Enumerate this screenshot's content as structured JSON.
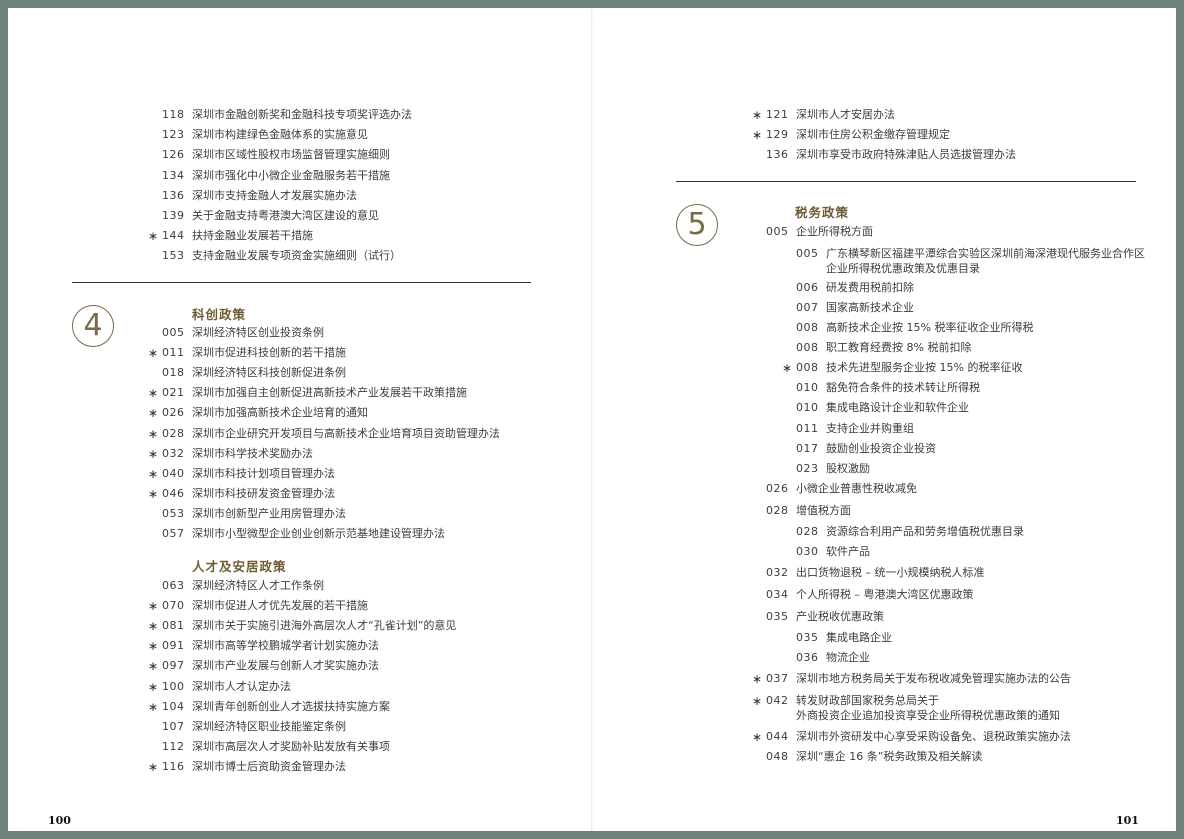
{
  "left": {
    "top_items": [
      {
        "num": "118",
        "title": "深圳市金融创新奖和金融科技专项奖评选办法",
        "star": false
      },
      {
        "num": "123",
        "title": "深圳市构建绿色金融体系的实施意见",
        "star": false
      },
      {
        "num": "126",
        "title": "深圳市区域性股权市场监督管理实施细则",
        "star": false
      },
      {
        "num": "134",
        "title": "深圳市强化中小微企业金融服务若干措施",
        "star": false
      },
      {
        "num": "136",
        "title": "深圳市支持金融人才发展实施办法",
        "star": false
      },
      {
        "num": "139",
        "title": "关于金融支持粤港澳大湾区建设的意见",
        "star": false
      },
      {
        "num": "144",
        "title": "扶持金融业发展若干措施",
        "star": true
      },
      {
        "num": "153",
        "title": "支持金融业发展专项资金实施细则（试行）",
        "star": false
      }
    ],
    "section_number": "4",
    "heading_kechuang": "科创政策",
    "kechuang_items": [
      {
        "num": "005",
        "title": "深圳经济特区创业投资条例",
        "star": false
      },
      {
        "num": "011",
        "title": "深圳市促进科技创新的若干措施",
        "star": true
      },
      {
        "num": "018",
        "title": "深圳经济特区科技创新促进条例",
        "star": false
      },
      {
        "num": "021",
        "title": "深圳市加强自主创新促进高新技术产业发展若干政策措施",
        "star": true
      },
      {
        "num": "026",
        "title": "深圳市加强高新技术企业培育的通知",
        "star": true
      },
      {
        "num": "028",
        "title": "深圳市企业研究开发项目与高新技术企业培育项目资助管理办法",
        "star": true
      },
      {
        "num": "032",
        "title": "深圳市科学技术奖励办法",
        "star": true
      },
      {
        "num": "040",
        "title": "深圳市科技计划项目管理办法",
        "star": true
      },
      {
        "num": "046",
        "title": "深圳市科技研发资金管理办法",
        "star": true
      },
      {
        "num": "053",
        "title": "深圳市创新型产业用房管理办法",
        "star": false
      },
      {
        "num": "057",
        "title": "深圳市小型微型企业创业创新示范基地建设管理办法",
        "star": false
      }
    ],
    "heading_rencai": "人才及安居政策",
    "rencai_items": [
      {
        "num": "063",
        "title": "深圳经济特区人才工作条例",
        "star": false
      },
      {
        "num": "070",
        "title": "深圳市促进人才优先发展的若干措施",
        "star": true
      },
      {
        "num": "081",
        "title": "深圳市关于实施引进海外高层次人才“孔雀计划”的意见",
        "star": true
      },
      {
        "num": "091",
        "title": "深圳市高等学校鹏城学者计划实施办法",
        "star": true
      },
      {
        "num": "097",
        "title": "深圳市产业发展与创新人才奖实施办法",
        "star": true
      },
      {
        "num": "100",
        "title": "深圳市人才认定办法",
        "star": true
      },
      {
        "num": "104",
        "title": "深圳青年创新创业人才选拔扶持实施方案",
        "star": true
      },
      {
        "num": "107",
        "title": "深圳经济特区职业技能鉴定条例",
        "star": false
      },
      {
        "num": "112",
        "title": "深圳市高层次人才奖励补贴发放有关事项",
        "star": false
      },
      {
        "num": "116",
        "title": "深圳市博士后资助资金管理办法",
        "star": true
      }
    ],
    "page_number": "100"
  },
  "right": {
    "top_items": [
      {
        "num": "121",
        "title": "深圳市人才安居办法",
        "star": true
      },
      {
        "num": "129",
        "title": "深圳市住房公积金缴存管理规定",
        "star": true
      },
      {
        "num": "136",
        "title": "深圳市享受市政府特殊津贴人员选拔管理办法",
        "star": false
      }
    ],
    "section_number": "5",
    "heading_shuiwu": "税务政策",
    "tax_items": [
      {
        "num": "005",
        "title": "企业所得税方面",
        "star": false,
        "level": 0
      },
      {
        "num": "005",
        "title": "广东横琴新区福建平潭综合实验区深圳前海深港现代服务业合作区",
        "sub": "企业所得税优惠政策及优惠目录",
        "star": false,
        "level": 1
      },
      {
        "num": "006",
        "title": "研发费用税前扣除",
        "star": false,
        "level": 1
      },
      {
        "num": "007",
        "title": "国家高新技术企业",
        "star": false,
        "level": 1
      },
      {
        "num": "008",
        "title": "高新技术企业按 15% 税率征收企业所得税",
        "star": false,
        "level": 1
      },
      {
        "num": "008",
        "title": "职工教育经费按 8% 税前扣除",
        "star": false,
        "level": 1
      },
      {
        "num": "008",
        "title": "技术先进型服务企业按 15% 的税率征收",
        "star": true,
        "level": 1
      },
      {
        "num": "010",
        "title": "豁免符合条件的技术转让所得税",
        "star": false,
        "level": 1
      },
      {
        "num": "010",
        "title": "集成电路设计企业和软件企业",
        "star": false,
        "level": 1
      },
      {
        "num": "011",
        "title": "支持企业并购重组",
        "star": false,
        "level": 1
      },
      {
        "num": "017",
        "title": "鼓励创业投资企业投资",
        "star": false,
        "level": 1
      },
      {
        "num": "023",
        "title": "股权激励",
        "star": false,
        "level": 1
      },
      {
        "num": "026",
        "title": "小微企业普惠性税收减免",
        "star": false,
        "level": 0
      },
      {
        "num": "028",
        "title": "增值税方面",
        "star": false,
        "level": 0
      },
      {
        "num": "028",
        "title": "资源综合利用产品和劳务增值税优惠目录",
        "star": false,
        "level": 1
      },
      {
        "num": "030",
        "title": "软件产品",
        "star": false,
        "level": 1
      },
      {
        "num": "032",
        "title": "出口货物退税 – 统一小规模纳税人标准",
        "star": false,
        "level": 0
      },
      {
        "num": "034",
        "title": "个人所得税 – 粤港澳大湾区优惠政策",
        "star": false,
        "level": 0
      },
      {
        "num": "035",
        "title": "产业税收优惠政策",
        "star": false,
        "level": 0
      },
      {
        "num": "035",
        "title": "集成电路企业",
        "star": false,
        "level": 1
      },
      {
        "num": "036",
        "title": "物流企业",
        "star": false,
        "level": 1
      },
      {
        "num": "037",
        "title": "深圳市地方税务局关于发布税收减免管理实施办法的公告",
        "star": true,
        "level": 0
      },
      {
        "num": "042",
        "title": "转发财政部国家税务总局关于",
        "sub": "外商投资企业追加投资享受企业所得税优惠政策的通知",
        "star": true,
        "level": 0
      },
      {
        "num": "044",
        "title": "深圳市外资研发中心享受采购设备免、退税政策实施办法",
        "star": true,
        "level": 0
      },
      {
        "num": "048",
        "title": "深圳“惠企 16 条”税务政策及相关解读",
        "star": false,
        "level": 0
      }
    ],
    "page_number": "101"
  }
}
